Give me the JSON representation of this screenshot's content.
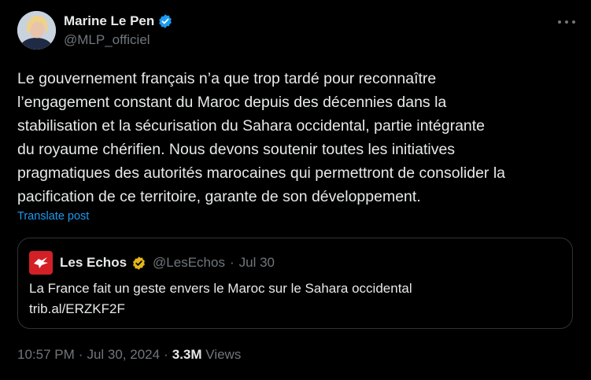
{
  "author": {
    "display_name": "Marine Le Pen",
    "handle": "@MLP_officiel",
    "verified_color": "#1d9bf0"
  },
  "post": {
    "text": "Le gouvernement français n’a que trop tardé pour reconnaître\nl’engagement constant du Maroc depuis des décennies dans la\nstabilisation et la sécurisation  du Sahara occidental, partie intégrante\ndu royaume chérifien. Nous devons soutenir toutes les initiatives\npragmatiques des autorités marocaines qui permettront de consolider la\npacification de ce territoire, garante de son développement.",
    "translate_label": "Translate post"
  },
  "quote": {
    "display_name": "Les Echos",
    "handle": "@LesEchos",
    "separator": "·",
    "date": "Jul 30",
    "line1": "La France fait un geste envers le Maroc sur le Sahara occidental",
    "line2": "trib.al/ERZKF2F",
    "badge_color": "#e2b719",
    "logo_color": "#d32027"
  },
  "meta": {
    "time": "10:57 PM",
    "sep1": "·",
    "date": "Jul 30, 2024",
    "sep2": "·",
    "views_count": "3.3M",
    "views_label": "Views"
  },
  "icons": {
    "more": "more-horizontal-icon",
    "verified": "verified-badge-icon",
    "gold_verified": "gold-verified-badge-icon"
  }
}
